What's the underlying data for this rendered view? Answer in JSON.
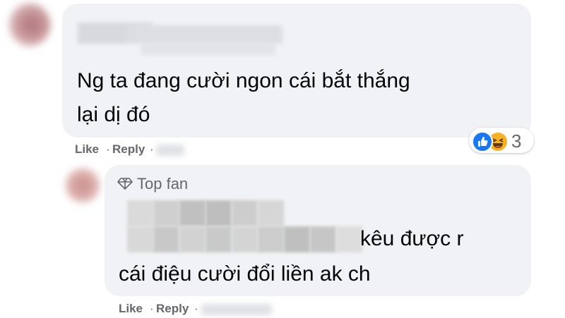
{
  "comment1": {
    "author_obscured": true,
    "lines": [
      "Ng ta đang cười ngon cái bắt thắng",
      "lại dị đó"
    ],
    "actions": {
      "like": "Like",
      "reply": "Reply",
      "separator": "·"
    },
    "reactions": {
      "icons": [
        "like-icon",
        "haha-icon"
      ],
      "count": "3"
    }
  },
  "comment2": {
    "badge": "Top fan",
    "badge_icon": "diamond-icon",
    "author_obscured": true,
    "lines": [
      "kêu được r",
      "cái điệu cười đổi liền ak ch"
    ],
    "actions": {
      "like": "Like",
      "reply": "Reply",
      "separator": "·"
    }
  },
  "colors": {
    "bubble": "#f0f2f5",
    "action_text": "#65676b",
    "body_text": "#050505",
    "like_blue": "#1877f2",
    "haha_yellow": "#f7b125"
  }
}
